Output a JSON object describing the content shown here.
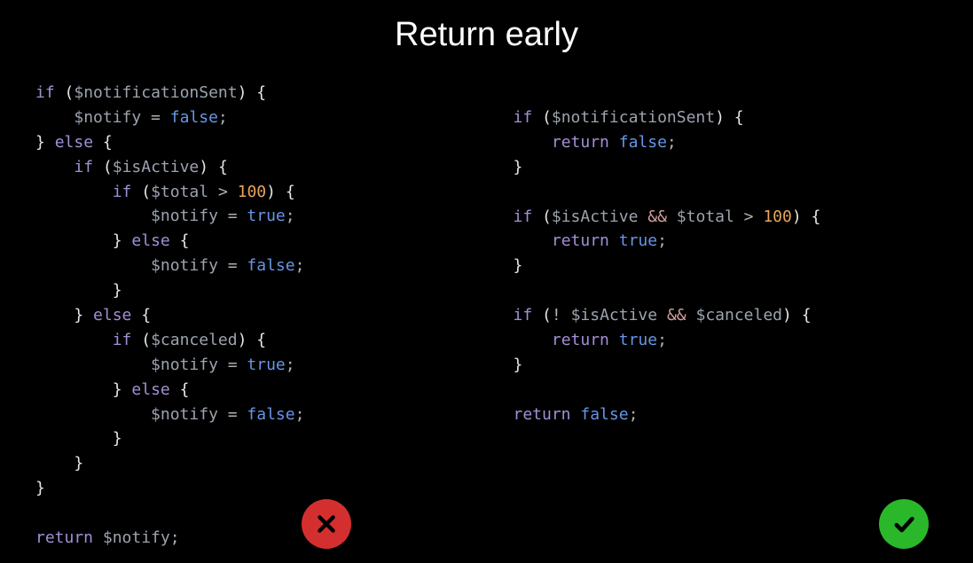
{
  "title": "Return early",
  "left": {
    "tokens": [
      {
        "t": "kw",
        "v": "if"
      },
      {
        "t": "punct",
        "v": " ("
      },
      {
        "t": "var",
        "v": "$notificationSent"
      },
      {
        "t": "punct",
        "v": ") {"
      },
      {
        "t": "nl"
      },
      {
        "t": "txt",
        "v": "    "
      },
      {
        "t": "var",
        "v": "$notify"
      },
      {
        "t": "op",
        "v": " = "
      },
      {
        "t": "bool",
        "v": "false"
      },
      {
        "t": "op",
        "v": ";"
      },
      {
        "t": "nl"
      },
      {
        "t": "punct",
        "v": "} "
      },
      {
        "t": "kw",
        "v": "else"
      },
      {
        "t": "punct",
        "v": " {"
      },
      {
        "t": "nl"
      },
      {
        "t": "txt",
        "v": "    "
      },
      {
        "t": "kw",
        "v": "if"
      },
      {
        "t": "punct",
        "v": " ("
      },
      {
        "t": "var",
        "v": "$isActive"
      },
      {
        "t": "punct",
        "v": ") {"
      },
      {
        "t": "nl"
      },
      {
        "t": "txt",
        "v": "        "
      },
      {
        "t": "kw",
        "v": "if"
      },
      {
        "t": "punct",
        "v": " ("
      },
      {
        "t": "var",
        "v": "$total"
      },
      {
        "t": "op",
        "v": " > "
      },
      {
        "t": "num",
        "v": "100"
      },
      {
        "t": "punct",
        "v": ") {"
      },
      {
        "t": "nl"
      },
      {
        "t": "txt",
        "v": "            "
      },
      {
        "t": "var",
        "v": "$notify"
      },
      {
        "t": "op",
        "v": " = "
      },
      {
        "t": "bool",
        "v": "true"
      },
      {
        "t": "op",
        "v": ";"
      },
      {
        "t": "nl"
      },
      {
        "t": "txt",
        "v": "        "
      },
      {
        "t": "punct",
        "v": "} "
      },
      {
        "t": "kw",
        "v": "else"
      },
      {
        "t": "punct",
        "v": " {"
      },
      {
        "t": "nl"
      },
      {
        "t": "txt",
        "v": "            "
      },
      {
        "t": "var",
        "v": "$notify"
      },
      {
        "t": "op",
        "v": " = "
      },
      {
        "t": "bool",
        "v": "false"
      },
      {
        "t": "op",
        "v": ";"
      },
      {
        "t": "nl"
      },
      {
        "t": "txt",
        "v": "        "
      },
      {
        "t": "punct",
        "v": "}"
      },
      {
        "t": "nl"
      },
      {
        "t": "txt",
        "v": "    "
      },
      {
        "t": "punct",
        "v": "} "
      },
      {
        "t": "kw",
        "v": "else"
      },
      {
        "t": "punct",
        "v": " {"
      },
      {
        "t": "nl"
      },
      {
        "t": "txt",
        "v": "        "
      },
      {
        "t": "kw",
        "v": "if"
      },
      {
        "t": "punct",
        "v": " ("
      },
      {
        "t": "var",
        "v": "$canceled"
      },
      {
        "t": "punct",
        "v": ") {"
      },
      {
        "t": "nl"
      },
      {
        "t": "txt",
        "v": "            "
      },
      {
        "t": "var",
        "v": "$notify"
      },
      {
        "t": "op",
        "v": " = "
      },
      {
        "t": "bool",
        "v": "true"
      },
      {
        "t": "op",
        "v": ";"
      },
      {
        "t": "nl"
      },
      {
        "t": "txt",
        "v": "        "
      },
      {
        "t": "punct",
        "v": "} "
      },
      {
        "t": "kw",
        "v": "else"
      },
      {
        "t": "punct",
        "v": " {"
      },
      {
        "t": "nl"
      },
      {
        "t": "txt",
        "v": "            "
      },
      {
        "t": "var",
        "v": "$notify"
      },
      {
        "t": "op",
        "v": " = "
      },
      {
        "t": "bool",
        "v": "false"
      },
      {
        "t": "op",
        "v": ";"
      },
      {
        "t": "nl"
      },
      {
        "t": "txt",
        "v": "        "
      },
      {
        "t": "punct",
        "v": "}"
      },
      {
        "t": "nl"
      },
      {
        "t": "txt",
        "v": "    "
      },
      {
        "t": "punct",
        "v": "}"
      },
      {
        "t": "nl"
      },
      {
        "t": "punct",
        "v": "}"
      },
      {
        "t": "nl"
      },
      {
        "t": "nl"
      },
      {
        "t": "kw",
        "v": "return"
      },
      {
        "t": "txt",
        "v": " "
      },
      {
        "t": "var",
        "v": "$notify"
      },
      {
        "t": "op",
        "v": ";"
      }
    ]
  },
  "right": {
    "tokens": [
      {
        "t": "kw",
        "v": "if"
      },
      {
        "t": "punct",
        "v": " ("
      },
      {
        "t": "var",
        "v": "$notificationSent"
      },
      {
        "t": "punct",
        "v": ") {"
      },
      {
        "t": "nl"
      },
      {
        "t": "txt",
        "v": "    "
      },
      {
        "t": "kw",
        "v": "return"
      },
      {
        "t": "txt",
        "v": " "
      },
      {
        "t": "bool",
        "v": "false"
      },
      {
        "t": "op",
        "v": ";"
      },
      {
        "t": "nl"
      },
      {
        "t": "punct",
        "v": "}"
      },
      {
        "t": "nl"
      },
      {
        "t": "nl"
      },
      {
        "t": "kw",
        "v": "if"
      },
      {
        "t": "punct",
        "v": " ("
      },
      {
        "t": "var",
        "v": "$isActive"
      },
      {
        "t": "txt",
        "v": " "
      },
      {
        "t": "amp",
        "v": "&&"
      },
      {
        "t": "txt",
        "v": " "
      },
      {
        "t": "var",
        "v": "$total"
      },
      {
        "t": "op",
        "v": " > "
      },
      {
        "t": "num",
        "v": "100"
      },
      {
        "t": "punct",
        "v": ") {"
      },
      {
        "t": "nl"
      },
      {
        "t": "txt",
        "v": "    "
      },
      {
        "t": "kw",
        "v": "return"
      },
      {
        "t": "txt",
        "v": " "
      },
      {
        "t": "bool",
        "v": "true"
      },
      {
        "t": "op",
        "v": ";"
      },
      {
        "t": "nl"
      },
      {
        "t": "punct",
        "v": "}"
      },
      {
        "t": "nl"
      },
      {
        "t": "nl"
      },
      {
        "t": "kw",
        "v": "if"
      },
      {
        "t": "punct",
        "v": " ("
      },
      {
        "t": "op",
        "v": "! "
      },
      {
        "t": "var",
        "v": "$isActive"
      },
      {
        "t": "txt",
        "v": " "
      },
      {
        "t": "amp",
        "v": "&&"
      },
      {
        "t": "txt",
        "v": " "
      },
      {
        "t": "var",
        "v": "$canceled"
      },
      {
        "t": "punct",
        "v": ") {"
      },
      {
        "t": "nl"
      },
      {
        "t": "txt",
        "v": "    "
      },
      {
        "t": "kw",
        "v": "return"
      },
      {
        "t": "txt",
        "v": " "
      },
      {
        "t": "bool",
        "v": "true"
      },
      {
        "t": "op",
        "v": ";"
      },
      {
        "t": "nl"
      },
      {
        "t": "punct",
        "v": "}"
      },
      {
        "t": "nl"
      },
      {
        "t": "nl"
      },
      {
        "t": "kw",
        "v": "return"
      },
      {
        "t": "txt",
        "v": " "
      },
      {
        "t": "bool",
        "v": "false"
      },
      {
        "t": "op",
        "v": ";"
      }
    ]
  },
  "badges": {
    "bad": "cross-icon",
    "good": "check-icon"
  }
}
